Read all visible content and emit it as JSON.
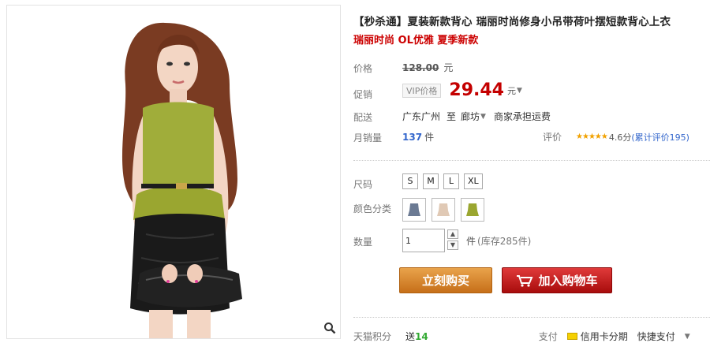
{
  "title": "【秒杀通】夏装新款背心 瑞丽时尚修身小吊带荷叶摆短款背心上衣",
  "subtitle": "瑞丽时尚 OL优雅 夏季新款",
  "price": {
    "label": "价格",
    "original": "128.00",
    "currency": "元"
  },
  "promo": {
    "label": "促销",
    "vip_tag": "VIP价格",
    "price": "29.44",
    "currency": "元"
  },
  "shipping": {
    "label": "配送",
    "from": "广东广州",
    "to_word": "至",
    "dest": "廊坊",
    "note": "商家承担运费"
  },
  "sales": {
    "label": "月销量",
    "count": "137",
    "unit": "件"
  },
  "rating": {
    "label": "评价",
    "stars": "★★★★★",
    "score": "4.6分",
    "review_link": "(累计评价195)",
    "stars_value": 4.6
  },
  "sizes": {
    "label": "尺码",
    "options": [
      "S",
      "M",
      "L",
      "XL"
    ]
  },
  "colors": {
    "label": "颜色分类",
    "swatches": [
      {
        "name": "gray-blue",
        "color": "#6b7a93"
      },
      {
        "name": "beige",
        "color": "#e0c9b5"
      },
      {
        "name": "green",
        "color": "#9aa630"
      }
    ]
  },
  "quantity": {
    "label": "数量",
    "value": "1",
    "unit": "件",
    "stock": "(库存285件)"
  },
  "buttons": {
    "buy_now": "立刻购买",
    "add_to_cart": "加入购物车"
  },
  "footer": {
    "points_label": "天猫积分",
    "points_prefix": "送",
    "points_value": "14",
    "pay_label": "支付",
    "credit_card": "信用卡分期",
    "quick_pay": "快捷支付"
  },
  "colors_theme": {
    "price_red": "#c40000",
    "subtitle_red": "#cc0000",
    "buy_button": "#d9822b",
    "cart_button": "#c81616",
    "link_blue": "#3366cc",
    "points_green": "#33aa33",
    "blouse_green": "#a0ad3a"
  },
  "icons": {
    "zoom": "magnifier-icon",
    "cart": "shopping-cart-icon",
    "card": "credit-card-icon"
  }
}
